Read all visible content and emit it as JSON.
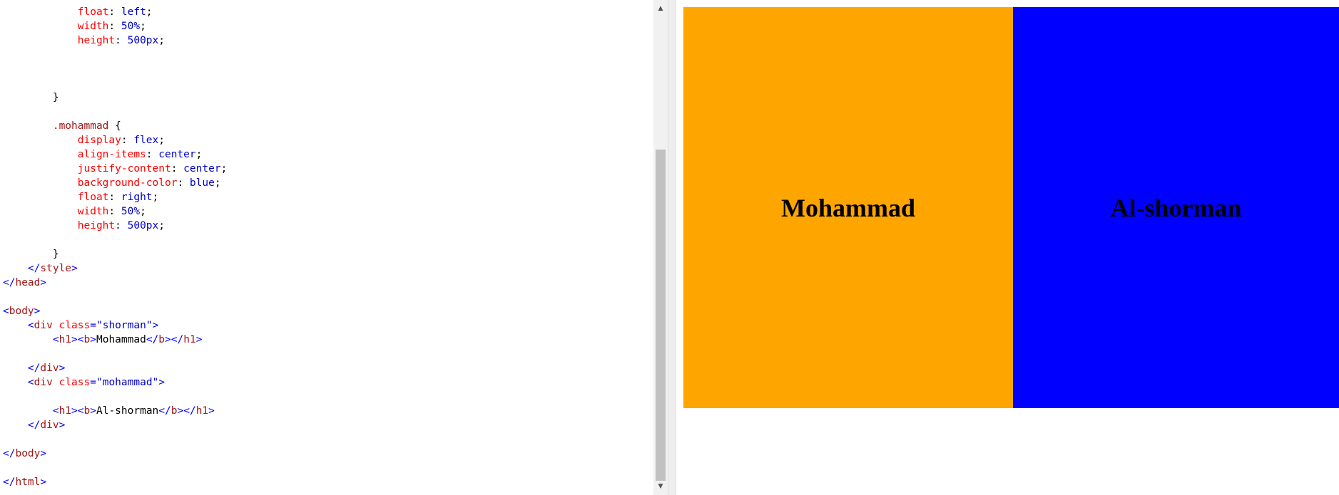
{
  "code_lines": [
    [
      {
        "c": "prop",
        "t": "            float"
      },
      {
        "c": "txt",
        "t": ": "
      },
      {
        "c": "val",
        "t": "left"
      },
      {
        "c": "txt",
        "t": ";"
      }
    ],
    [
      {
        "c": "prop",
        "t": "            width"
      },
      {
        "c": "txt",
        "t": ": "
      },
      {
        "c": "val",
        "t": "50%"
      },
      {
        "c": "txt",
        "t": ";"
      }
    ],
    [
      {
        "c": "prop",
        "t": "            height"
      },
      {
        "c": "txt",
        "t": ": "
      },
      {
        "c": "val",
        "t": "500px"
      },
      {
        "c": "txt",
        "t": ";"
      }
    ],
    [],
    [],
    [],
    [
      {
        "c": "txt",
        "t": "        }"
      }
    ],
    [],
    [
      {
        "c": "sel",
        "t": "        .mohammad"
      },
      {
        "c": "txt",
        "t": " {"
      }
    ],
    [
      {
        "c": "prop",
        "t": "            display"
      },
      {
        "c": "txt",
        "t": ": "
      },
      {
        "c": "val",
        "t": "flex"
      },
      {
        "c": "txt",
        "t": ";"
      }
    ],
    [
      {
        "c": "prop",
        "t": "            align-items"
      },
      {
        "c": "txt",
        "t": ": "
      },
      {
        "c": "val",
        "t": "center"
      },
      {
        "c": "txt",
        "t": ";"
      }
    ],
    [
      {
        "c": "prop",
        "t": "            justify-content"
      },
      {
        "c": "txt",
        "t": ": "
      },
      {
        "c": "val",
        "t": "center"
      },
      {
        "c": "txt",
        "t": ";"
      }
    ],
    [
      {
        "c": "prop",
        "t": "            background-color"
      },
      {
        "c": "txt",
        "t": ": "
      },
      {
        "c": "val",
        "t": "blue"
      },
      {
        "c": "txt",
        "t": ";"
      }
    ],
    [
      {
        "c": "prop",
        "t": "            float"
      },
      {
        "c": "txt",
        "t": ": "
      },
      {
        "c": "val",
        "t": "right"
      },
      {
        "c": "txt",
        "t": ";"
      }
    ],
    [
      {
        "c": "prop",
        "t": "            width"
      },
      {
        "c": "txt",
        "t": ": "
      },
      {
        "c": "val",
        "t": "50%"
      },
      {
        "c": "txt",
        "t": ";"
      }
    ],
    [
      {
        "c": "prop",
        "t": "            height"
      },
      {
        "c": "txt",
        "t": ": "
      },
      {
        "c": "val",
        "t": "500px"
      },
      {
        "c": "txt",
        "t": ";"
      }
    ],
    [],
    [
      {
        "c": "txt",
        "t": "        }"
      }
    ],
    [
      {
        "c": "br",
        "t": "    </"
      },
      {
        "c": "tag",
        "t": "style"
      },
      {
        "c": "br",
        "t": ">"
      }
    ],
    [
      {
        "c": "br",
        "t": "</"
      },
      {
        "c": "tag",
        "t": "head"
      },
      {
        "c": "br",
        "t": ">"
      }
    ],
    [],
    [
      {
        "c": "br",
        "t": "<"
      },
      {
        "c": "tag",
        "t": "body"
      },
      {
        "c": "br",
        "t": ">"
      }
    ],
    [
      {
        "c": "br",
        "t": "    <"
      },
      {
        "c": "tag",
        "t": "div"
      },
      {
        "c": "txt",
        "t": " "
      },
      {
        "c": "attr",
        "t": "class"
      },
      {
        "c": "br",
        "t": "="
      },
      {
        "c": "str",
        "t": "\"shorman\""
      },
      {
        "c": "br",
        "t": ">"
      }
    ],
    [
      {
        "c": "br",
        "t": "        <"
      },
      {
        "c": "tag",
        "t": "h1"
      },
      {
        "c": "br",
        "t": "><"
      },
      {
        "c": "tag",
        "t": "b"
      },
      {
        "c": "br",
        "t": ">"
      },
      {
        "c": "txt",
        "t": "Mohammad"
      },
      {
        "c": "br",
        "t": "</"
      },
      {
        "c": "tag",
        "t": "b"
      },
      {
        "c": "br",
        "t": "></"
      },
      {
        "c": "tag",
        "t": "h1"
      },
      {
        "c": "br",
        "t": ">"
      }
    ],
    [],
    [
      {
        "c": "br",
        "t": "    </"
      },
      {
        "c": "tag",
        "t": "div"
      },
      {
        "c": "br",
        "t": ">"
      }
    ],
    [
      {
        "c": "br",
        "t": "    <"
      },
      {
        "c": "tag",
        "t": "div"
      },
      {
        "c": "txt",
        "t": " "
      },
      {
        "c": "attr",
        "t": "class"
      },
      {
        "c": "br",
        "t": "="
      },
      {
        "c": "str",
        "t": "\"mohammad\""
      },
      {
        "c": "br",
        "t": ">"
      }
    ],
    [],
    [
      {
        "c": "br",
        "t": "        <"
      },
      {
        "c": "tag",
        "t": "h1"
      },
      {
        "c": "br",
        "t": "><"
      },
      {
        "c": "tag",
        "t": "b"
      },
      {
        "c": "br",
        "t": ">"
      },
      {
        "c": "txt",
        "t": "Al-shorman"
      },
      {
        "c": "br",
        "t": "</"
      },
      {
        "c": "tag",
        "t": "b"
      },
      {
        "c": "br",
        "t": "></"
      },
      {
        "c": "tag",
        "t": "h1"
      },
      {
        "c": "br",
        "t": ">"
      }
    ],
    [
      {
        "c": "br",
        "t": "    </"
      },
      {
        "c": "tag",
        "t": "div"
      },
      {
        "c": "br",
        "t": ">"
      }
    ],
    [],
    [
      {
        "c": "br",
        "t": "</"
      },
      {
        "c": "tag",
        "t": "body"
      },
      {
        "c": "br",
        "t": ">"
      }
    ],
    [],
    [
      {
        "c": "br",
        "t": "</"
      },
      {
        "c": "tag",
        "t": "html"
      },
      {
        "c": "br",
        "t": ">"
      }
    ]
  ],
  "preview": {
    "left_box": {
      "text": "Mohammad",
      "color": "#ffa500"
    },
    "right_box": {
      "text": "Al-shorman",
      "color": "#0000ff"
    }
  },
  "scrollbar": {
    "up_icon": "▲",
    "down_icon": "▼"
  },
  "colors": {
    "selector": "#a31515",
    "property": "#ff0000",
    "value": "#0000cd",
    "tag_bracket": "#0000ff"
  }
}
